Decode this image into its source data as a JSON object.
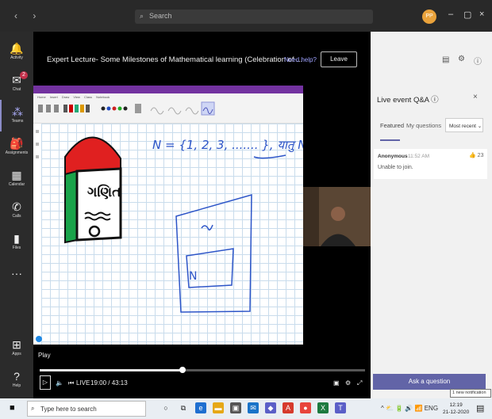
{
  "titlebar": {
    "search_placeholder": "Search",
    "avatar_initials": "PP"
  },
  "rail": [
    {
      "name": "activity",
      "label": "Activity",
      "glyph": "🔔"
    },
    {
      "name": "chat",
      "label": "Chat",
      "glyph": "✉",
      "badge": "2"
    },
    {
      "name": "teams",
      "label": "Teams",
      "glyph": "⁂",
      "active": true
    },
    {
      "name": "assignments",
      "label": "Assignments",
      "glyph": "🎒"
    },
    {
      "name": "calendar",
      "label": "Calendar",
      "glyph": "▦"
    },
    {
      "name": "calls",
      "label": "Calls",
      "glyph": "✆"
    },
    {
      "name": "files",
      "label": "Files",
      "glyph": "▮"
    },
    {
      "name": "more",
      "label": "",
      "glyph": "···"
    },
    {
      "name": "apps",
      "label": "Apps",
      "glyph": "⊞"
    },
    {
      "name": "help",
      "label": "Help",
      "glyph": "?"
    }
  ],
  "event": {
    "title": "Expert Lecture- Some Milestones of Mathematical learning (Celebration of ...",
    "need_help": "Need help?",
    "leave": "Leave"
  },
  "slide": {
    "tabs": "Home Insert Draw View Class Notebook",
    "set_notation": "N = {1, 2, 3, ....... },  यातु Ns",
    "book_word": "ગણિત",
    "box_label": "N"
  },
  "player": {
    "play_tooltip": "Play",
    "live": "LIVE",
    "time": "19:00 / 43:13",
    "progress": 0.44
  },
  "qa": {
    "title": "Live event Q&A",
    "tabs": [
      "Featured",
      "My questions"
    ],
    "sort": "Most recent",
    "question": {
      "author": "Anonymous",
      "time": "11:52 AM",
      "text": "Unable to join.",
      "likes": "23"
    },
    "ask_button": "Ask a question",
    "tooltip": "1 new notification"
  },
  "taskbar": {
    "search_placeholder": "Type here to search",
    "lang": "ENG",
    "time": "12:19",
    "date": "21-12-2020"
  },
  "colors": {
    "accent": "#6264a7",
    "onenote": "#7332a0",
    "ink": "#2d55c8"
  }
}
